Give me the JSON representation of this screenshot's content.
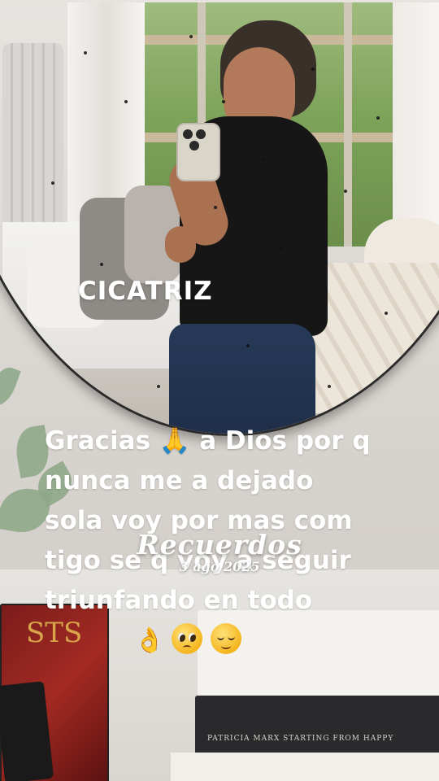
{
  "story": {
    "sticker_label": "CICATRIZ",
    "caption_lines": [
      "Gracias 🙏 a Dios por q",
      "nunca me a dejado",
      "sola voy por mas com",
      "tigo se q voy a seguir",
      "triunfando en todo"
    ],
    "emojis": [
      "ok-hand-emoji",
      "pleading-face-emoji",
      "relieved-face-emoji"
    ],
    "memories": {
      "title": "Recuerdos",
      "date": "3 ago 2025"
    },
    "book_spine_text": "PATRICIA MARX     STARTING FROM HAPPY",
    "book_red_text": "STS"
  }
}
